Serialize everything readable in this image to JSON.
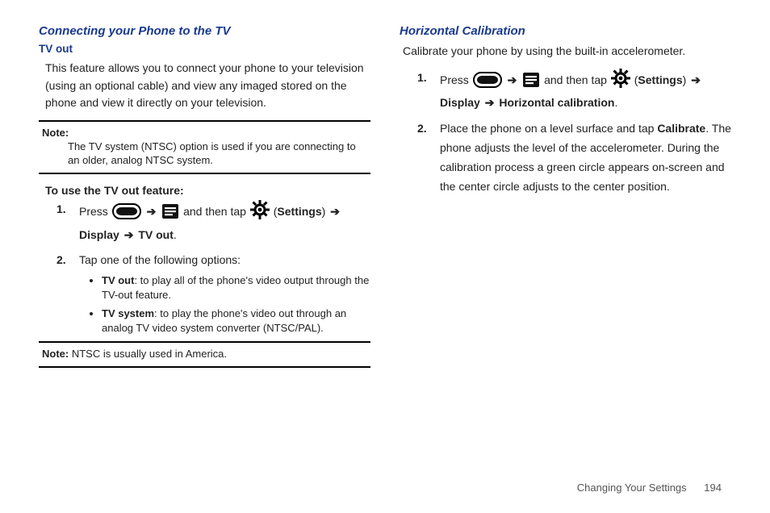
{
  "left": {
    "section_heading": "Connecting your Phone to the TV",
    "sub_heading": "TV out",
    "intro": "This feature allows you to connect your phone to your television (using an optional cable) and view any imaged stored on the phone and view it directly on your television.",
    "note1_label": "Note:",
    "note1_text": "The TV system (NTSC) option is used if you are connecting to an older, analog NTSC system.",
    "instr_head": "To use the TV out feature:",
    "step1_press": "Press ",
    "step1_andthen": " and then tap ",
    "step1_settings_open": " (",
    "step1_settings": "Settings",
    "step1_settings_close": ") ",
    "step1_display": "Display",
    "step1_tvout": "TV out",
    "step1_period": ".",
    "step2": "Tap one of the following options:",
    "bullet1_b": "TV out",
    "bullet1": ": to play all of the phone's video output through the TV-out feature.",
    "bullet2_b": "TV system",
    "bullet2": ": to play the phone's video out through an analog TV video system converter (NTSC/PAL).",
    "note2_label": "Note:",
    "note2_text": " NTSC is usually used in America."
  },
  "right": {
    "section_heading": "Horizontal Calibration",
    "intro": "Calibrate your phone by using the built-in accelerometer.",
    "step1_press": "Press ",
    "step1_andthen": " and then tap ",
    "step1_settings_open": " (",
    "step1_settings": "Settings",
    "step1_settings_close": ") ",
    "step1_display": "Display",
    "step1_hcal": "Horizontal calibration",
    "step1_period": ".",
    "step2_a": "Place the phone on a level surface and tap ",
    "step2_cal": "Calibrate",
    "step2_b": ". The phone adjusts the level of the accelerometer. During the calibration process a green circle appears on-screen and the center circle adjusts to the center position."
  },
  "arrow": "➔",
  "footer_section": "Changing Your Settings",
  "footer_page": "194"
}
